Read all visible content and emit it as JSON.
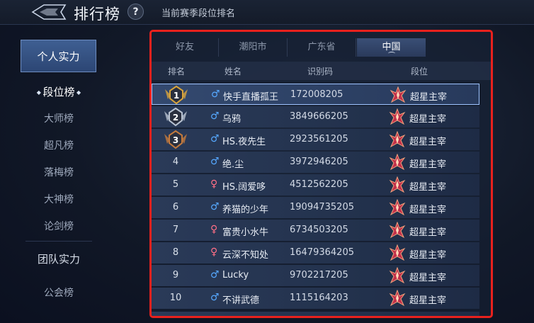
{
  "header": {
    "title": "排行榜",
    "help_label": "?",
    "subtitle": "当前赛季段位排名"
  },
  "sidebar": {
    "personal_label": "个人实力",
    "personal_items": [
      "段位榜",
      "大师榜",
      "超凡榜",
      "落梅榜",
      "大神榜",
      "论剑榜"
    ],
    "team_label": "团队实力",
    "team_items": [
      "公会榜"
    ]
  },
  "tabs": [
    "好友",
    "潮阳市",
    "广东省",
    "中国"
  ],
  "active_tab": "中国",
  "columns": {
    "rank": "排名",
    "name": "姓名",
    "id": "识别码",
    "tier": "段位"
  },
  "rows": [
    {
      "rank": "1",
      "medal": "gold",
      "gender": "male",
      "name": "快手直播孤王",
      "id": "172008205",
      "tier": "超星主宰"
    },
    {
      "rank": "2",
      "medal": "silver",
      "gender": "male",
      "name": "乌鸦",
      "id": "3849666205",
      "tier": "超星主宰"
    },
    {
      "rank": "3",
      "medal": "bronze",
      "gender": "male",
      "name": "HS.夜先生",
      "id": "2923561205",
      "tier": "超星主宰"
    },
    {
      "rank": "4",
      "medal": "",
      "gender": "male",
      "name": "绝.尘",
      "id": "3972946205",
      "tier": "超星主宰"
    },
    {
      "rank": "5",
      "medal": "",
      "gender": "female",
      "name": "HS.阔爱哆",
      "id": "4512562205",
      "tier": "超星主宰"
    },
    {
      "rank": "6",
      "medal": "",
      "gender": "male",
      "name": "养猫的少年",
      "id": "19094735205",
      "tier": "超星主宰"
    },
    {
      "rank": "7",
      "medal": "",
      "gender": "female",
      "name": "富贵小水牛",
      "id": "6734503205",
      "tier": "超星主宰"
    },
    {
      "rank": "8",
      "medal": "",
      "gender": "female",
      "name": "云深不知处",
      "id": "16479364205",
      "tier": "超星主宰"
    },
    {
      "rank": "9",
      "medal": "",
      "gender": "male",
      "name": "Lucky",
      "id": "9702217205",
      "tier": "超星主宰"
    },
    {
      "rank": "10",
      "medal": "",
      "gender": "male",
      "name": "不讲武德",
      "id": "1115164203",
      "tier": "超星主宰"
    }
  ],
  "colors": {
    "highlight_border": "#e8211d",
    "male": "#56a8ff",
    "female": "#ff6f86",
    "gold": "#d9a53c",
    "silver": "#b9c3d2",
    "bronze": "#c47a3d"
  },
  "icons": {
    "back": "back-arrow-icon",
    "help": "help-icon",
    "tier": "tier-emblem-icon",
    "male": "male-icon",
    "female": "female-icon"
  }
}
